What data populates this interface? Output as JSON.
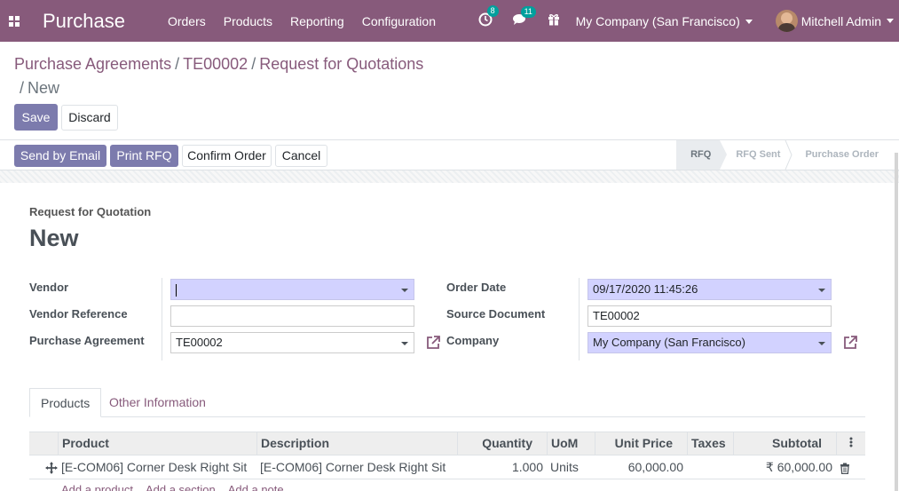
{
  "navbar": {
    "app_name": "Purchase",
    "menus": [
      "Orders",
      "Products",
      "Reporting",
      "Configuration"
    ],
    "activity_count": "8",
    "message_count": "11",
    "company": "My Company (San Francisco)",
    "user": "Mitchell Admin"
  },
  "breadcrumb": {
    "items": [
      "Purchase Agreements",
      "TE00002",
      "Request for Quotations"
    ],
    "current": "New"
  },
  "control": {
    "save_label": "Save",
    "discard_label": "Discard"
  },
  "header": {
    "send_email_label": "Send by Email",
    "print_rfq_label": "Print RFQ",
    "confirm_label": "Confirm Order",
    "cancel_label": "Cancel",
    "stages": [
      "RFQ",
      "RFQ Sent",
      "Purchase Order"
    ],
    "current_stage": "RFQ"
  },
  "form": {
    "doc_type_label": "Request for Quotation",
    "title": "New",
    "vendor_label": "Vendor",
    "vendor_value": "",
    "vendor_ref_label": "Vendor Reference",
    "vendor_ref_value": "",
    "agreement_label": "Purchase Agreement",
    "agreement_value": "TE00002",
    "order_date_label": "Order Date",
    "order_date_value": "09/17/2020 11:45:26",
    "source_doc_label": "Source Document",
    "source_doc_value": "TE00002",
    "company_label": "Company",
    "company_value": "My Company (San Francisco)"
  },
  "tabs": {
    "products": "Products",
    "other_info": "Other Information"
  },
  "lines": {
    "headers": {
      "product": "Product",
      "description": "Description",
      "quantity": "Quantity",
      "uom": "UoM",
      "unit_price": "Unit Price",
      "taxes": "Taxes",
      "subtotal": "Subtotal"
    },
    "rows": [
      {
        "product": "[E-COM06] Corner Desk Right Sit",
        "description": "[E-COM06] Corner Desk Right Sit",
        "quantity": "1.000",
        "uom": "Units",
        "unit_price": "60,000.00",
        "taxes": "",
        "subtotal": "₹ 60,000.00"
      }
    ],
    "add_product": "Add a product",
    "add_section": "Add a section",
    "add_note": "Add a note"
  },
  "colors": {
    "brand": "#875a7b",
    "primary_button": "#7c7bad",
    "required_field": "#d2d2ff"
  }
}
